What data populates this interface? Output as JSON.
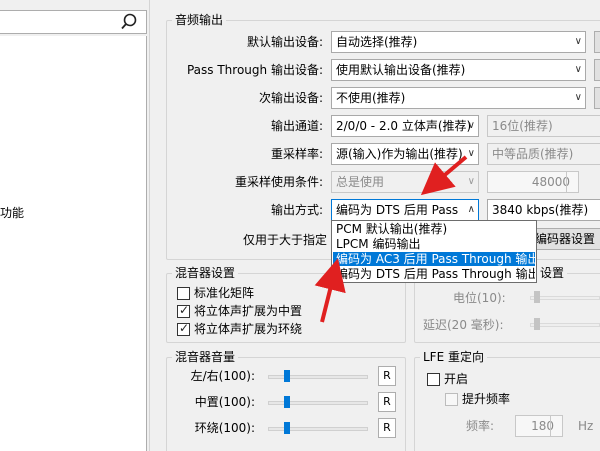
{
  "left": {
    "fragment": "功能"
  },
  "audio_output": {
    "title": "音频输出",
    "default_device": {
      "label": "默认输出设备:",
      "value": "自动选择(推荐)"
    },
    "passthrough_device": {
      "label": "Pass Through 输出设备:",
      "value": "使用默认输出设备(推荐)"
    },
    "secondary_device": {
      "label": "次输出设备:",
      "value": "不使用(推荐)"
    },
    "channel": {
      "label": "输出通道:",
      "value": "2/0/0 - 2.0 立体声(推荐)",
      "value2": "16位(推荐)"
    },
    "resample_rate": {
      "label": "重采样率:",
      "value": "源(输入)作为输出(推荐)",
      "value2": "中等品质(推荐)"
    },
    "resample_condition": {
      "label": "重采样使用条件:",
      "value": "总是使用",
      "number": "48000"
    },
    "output_mode": {
      "label": "输出方式:",
      "value": "编码为 DTS 后用 Pass Through 输出",
      "value2": "3840 kbps(推荐)"
    },
    "only_for_label": "仅用于大于指定",
    "encoder_settings_button": "编码器设置",
    "output_mode_options": [
      "PCM 默认输出(推荐)",
      "LPCM 编码输出",
      "编码为 AC3 后用 Pass Through 输出",
      "编码为 DTS 后用 Pass Through 输出"
    ]
  },
  "mixer_settings": {
    "title": "混音器设置",
    "normalize_matrix": "标准化矩阵",
    "expand_center": "将立体声扩展为中置",
    "expand_surround": "将立体声扩展为环绕",
    "checks": {
      "normalize": false,
      "center": true,
      "surround": true
    }
  },
  "right_settings": {
    "title_fragment": "设置",
    "level_label": "电位(10):",
    "delay_label": "延迟(20 毫秒):"
  },
  "mixer_volume": {
    "title": "混音器音量",
    "rows": [
      {
        "label": "左/右(100):",
        "reset": "R",
        "level": 0.17
      },
      {
        "label": "中置(100):",
        "reset": "R",
        "level": 0.17
      },
      {
        "label": "环绕(100):",
        "reset": "R",
        "level": 0.17
      }
    ]
  },
  "lfe": {
    "title": "LFE 重定向",
    "enable": "开启",
    "boost_freq": "提升频率",
    "freq_label": "频率:",
    "freq_value": "180",
    "freq_unit": "Hz"
  },
  "colors": {
    "accent": "#0078d7",
    "annotation_arrow": "#e02020"
  }
}
